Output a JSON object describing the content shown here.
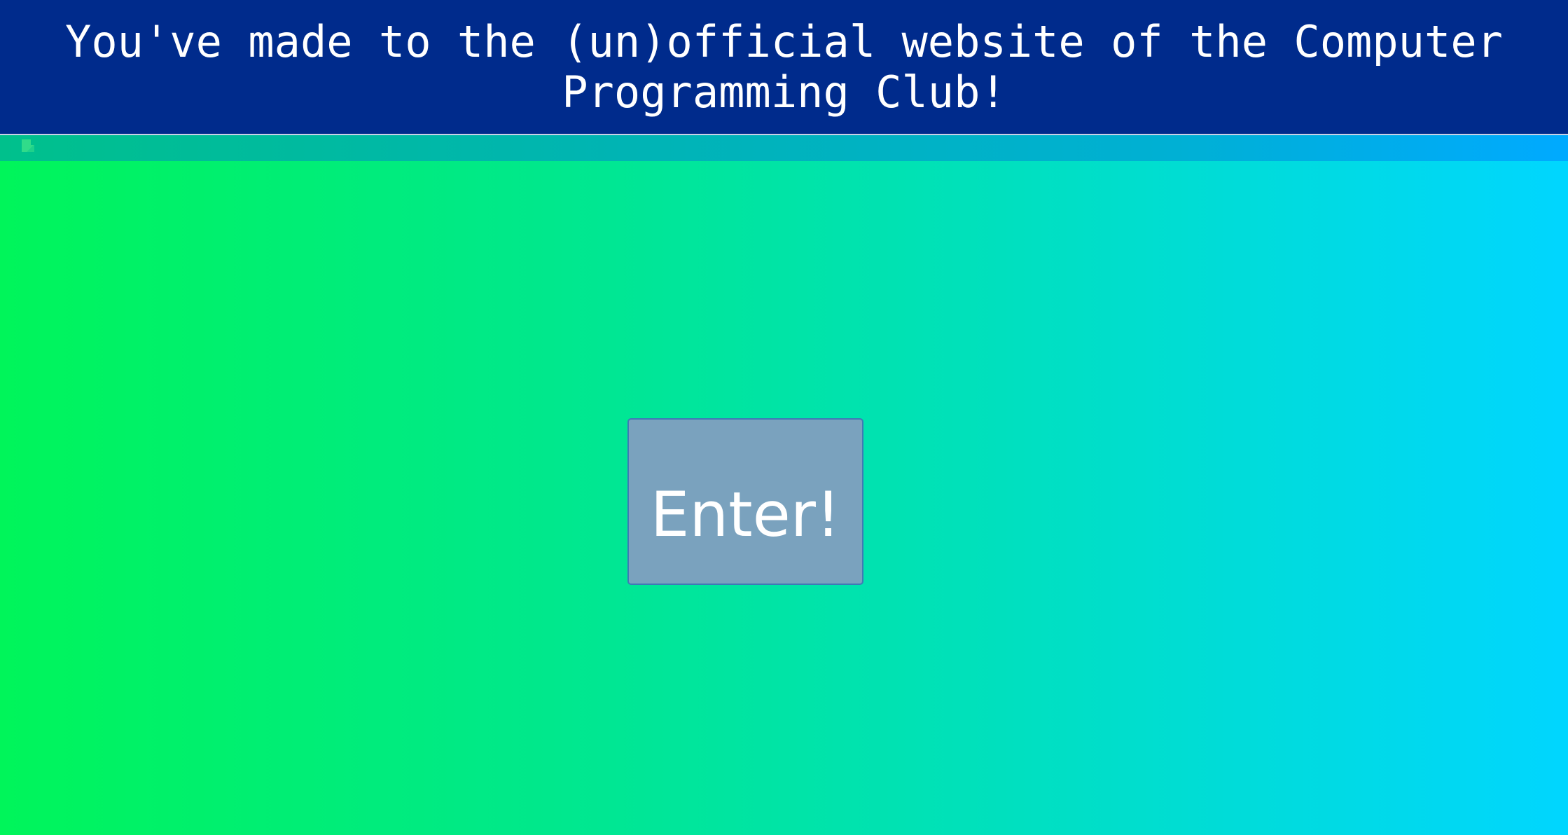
{
  "header": {
    "title": "You've made to the (un)official website of the Computer Programming Club!"
  },
  "strip": {
    "broken_image_icon": "broken-image-icon"
  },
  "main": {
    "enter_button_label": "Enter!"
  },
  "colors": {
    "header_background": "#002b8c",
    "header_text": "#ffffff",
    "gradient_left": "#00f55a",
    "gradient_right": "#00d6ff",
    "button_background": "#7aa2be",
    "button_border": "#3f79b6"
  }
}
